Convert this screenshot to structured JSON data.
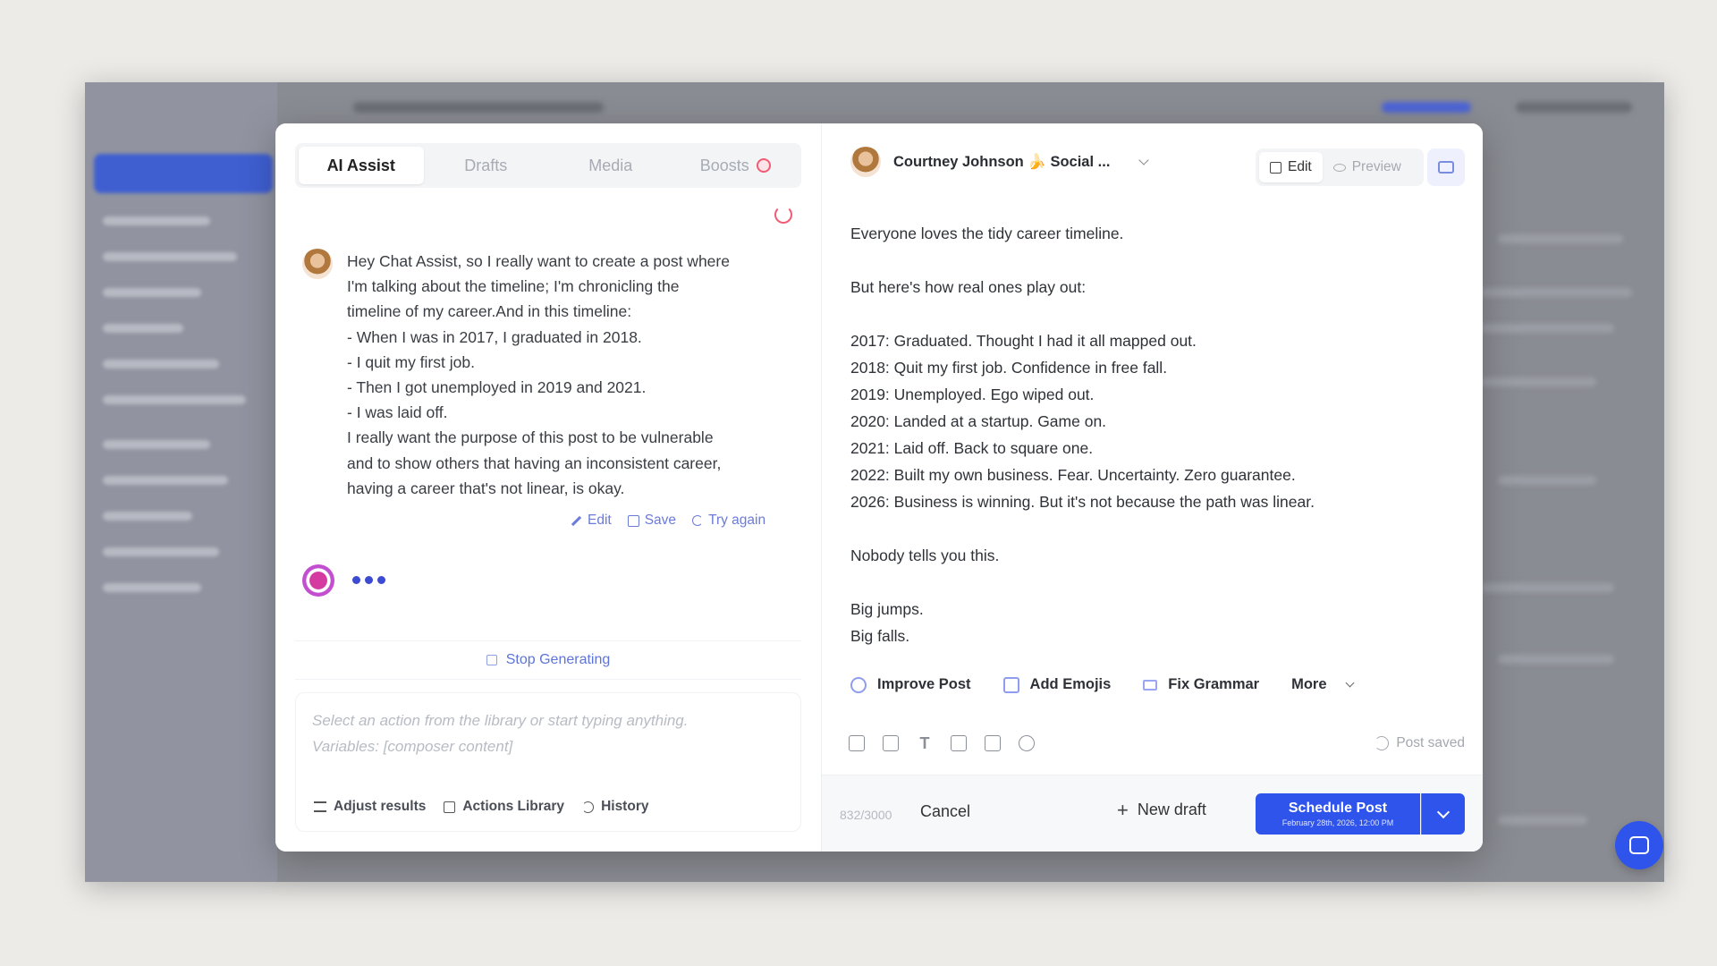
{
  "tabs": [
    {
      "label": "AI Assist"
    },
    {
      "label": "Drafts"
    },
    {
      "label": "Media"
    },
    {
      "label": "Boosts"
    }
  ],
  "user_message": {
    "lines": [
      "Hey Chat Assist, so I really want to create a post where",
      "I'm talking about the timeline; I'm chronicling the",
      "timeline of my career.And in this timeline:",
      "- When I was in 2017, I graduated in 2018.",
      "- I quit my first job.",
      "- Then I got unemployed in 2019 and 2021.",
      "- I was laid off.",
      "I really want the purpose of this post to be vulnerable",
      "and to show others that having an inconsistent career,",
      "having a career that's not linear, is okay."
    ],
    "actions": {
      "edit": "Edit",
      "save": "Save",
      "try_again": "Try again"
    }
  },
  "stop_label": "Stop Generating",
  "composer": {
    "placeholder_line1": "Select an action from the library or start typing anything.",
    "placeholder_line2": "Variables: [composer content]",
    "tools": {
      "adjust": "Adjust results",
      "library": "Actions Library",
      "history": "History"
    }
  },
  "editor": {
    "account": "Courtney Johnson 🍌 Social ...",
    "mode": {
      "edit": "Edit",
      "preview": "Preview"
    },
    "post_lines": [
      "Everyone loves the tidy career timeline.",
      "",
      "But here's how real ones play out:",
      "",
      "2017: Graduated. Thought I had it all mapped out.",
      "2018: Quit my first job. Confidence in free fall.",
      "2019: Unemployed. Ego wiped out.",
      "2020: Landed at a startup. Game on.",
      "2021: Laid off. Back to square one.",
      "2022: Built my own business. Fear. Uncertainty. Zero guarantee.",
      "2026: Business is winning. But it's not because the path was linear.",
      "",
      "Nobody tells you this.",
      "",
      "Big jumps.",
      "Big falls."
    ],
    "ai_actions": {
      "improve": "Improve Post",
      "emojis": "Add Emojis",
      "grammar": "Fix Grammar",
      "more": "More"
    },
    "post_saved": "Post saved",
    "char_count": "832/3000",
    "cancel": "Cancel",
    "new_draft": "New draft",
    "schedule_label": "Schedule Post",
    "schedule_sub": "February 28th, 2026, 12:00 PM"
  }
}
